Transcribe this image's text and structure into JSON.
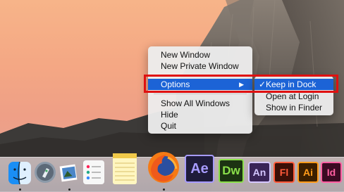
{
  "context_menu": {
    "items": [
      {
        "label": "New Window"
      },
      {
        "label": "New Private Window"
      },
      {
        "label": "Options"
      },
      {
        "label": "Show All Windows"
      },
      {
        "label": "Hide"
      },
      {
        "label": "Quit"
      }
    ]
  },
  "submenu": {
    "items": [
      {
        "label": "Keep in Dock",
        "checked": true
      },
      {
        "label": "Open at Login"
      },
      {
        "label": "Show in Finder"
      }
    ],
    "checkmark": "✓"
  },
  "dock": {
    "apps": [
      {
        "name": "finder-icon"
      },
      {
        "name": "launchpad-icon"
      },
      {
        "name": "preview-icon"
      },
      {
        "name": "reminders-icon"
      },
      {
        "name": "notes-icon"
      },
      {
        "name": "firefox-icon"
      },
      {
        "name": "after-effects-icon",
        "label": "Ae",
        "color": "#a79bff",
        "bg": "#1e1b3a"
      },
      {
        "name": "dreamweaver-icon",
        "label": "Dw",
        "color": "#8be04a",
        "bg": "#1c3312"
      },
      {
        "name": "animate-icon",
        "label": "An",
        "color": "#d5c7ff",
        "bg": "#3a2457"
      },
      {
        "name": "flash-icon",
        "label": "Fl",
        "color": "#ff5a3a",
        "bg": "#3b0f07"
      },
      {
        "name": "illustrator-icon",
        "label": "Ai",
        "color": "#ff9c1a",
        "bg": "#3b1f00"
      },
      {
        "name": "indesign-icon",
        "label": "Id",
        "color": "#ff5fa2",
        "bg": "#3b0a23"
      }
    ]
  },
  "colors": {
    "highlight": "#1c63d6",
    "annotation_box": "#e01010"
  }
}
